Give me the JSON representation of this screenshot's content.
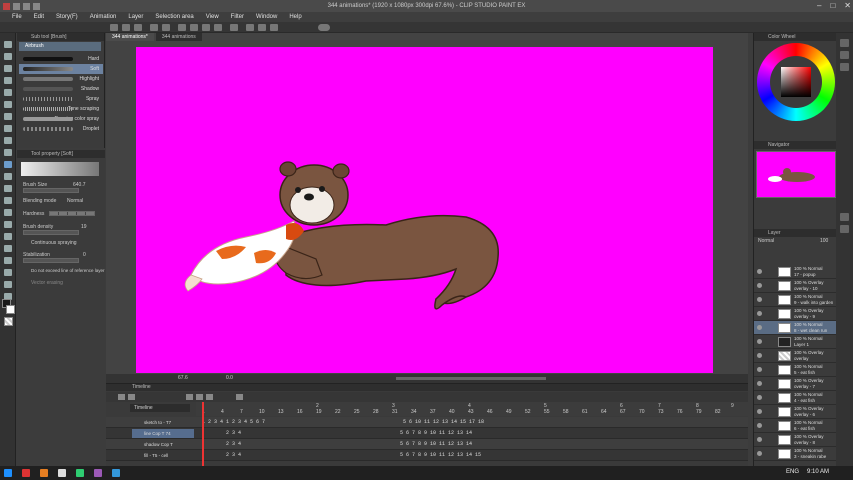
{
  "window": {
    "title": "344 animations* (1920 x 1080px 300dpi 67.6%)  -  CLIP STUDIO PAINT EX",
    "minimize": "–",
    "maximize": "□",
    "close": "✕"
  },
  "menu": [
    "File",
    "Edit",
    "Story(F)",
    "Animation",
    "Layer",
    "Selection area",
    "View",
    "Filter",
    "Window",
    "Help"
  ],
  "subtool": {
    "header": "Sub tool [Brush]",
    "tab": "Airbrush",
    "brushes": [
      "Hard",
      "Soft",
      "Highlight",
      "Shadow",
      "Spray",
      "Tone scraping",
      "Running color spray",
      "Droplet"
    ],
    "selected_index": 1
  },
  "toolprop": {
    "header": "Tool property [Soft]",
    "brush_size_label": "Brush Size",
    "brush_size_value": "640.7",
    "blending_label": "Blending mode",
    "blending_value": "Normal",
    "hardness_label": "Hardness",
    "density_label": "Brush density",
    "density_value": "19",
    "continuous_label": "Continuous spraying",
    "stabilization_label": "Stabilization",
    "stabilization_value": "0",
    "no_exceed_label": "Do not exceed line of reference layer",
    "vector_label": "Vector erasing"
  },
  "doc_tabs": [
    "344 animations*",
    "344 animations"
  ],
  "canvas": {
    "background": "#ff00ff",
    "zoom": "67.6",
    "angle": "0.0"
  },
  "timeline": {
    "header": "Timeline",
    "name_field": "Timeline",
    "ruler_bottom": [
      "1",
      "4",
      "7",
      "10",
      "13",
      "16",
      "19",
      "22",
      "25",
      "28",
      "31",
      "34",
      "37",
      "40",
      "43",
      "46",
      "49",
      "52",
      "55",
      "58",
      "61",
      "64",
      "67",
      "70",
      "73",
      "76",
      "79",
      "82"
    ],
    "ruler_top": [
      "2",
      "3",
      "4",
      "5",
      "6",
      "7",
      "8",
      "9"
    ],
    "tracks": [
      {
        "name": "sketch to - T7",
        "cells": "1 2 3 4 1 2 3 4 5 6 7                                              5 6 10 11 12 13 14 15 17 18"
      },
      {
        "name": "line Cop T 74",
        "cells": "        2 3 4                                                     5 6 7 8 9 10 11 12 13 14"
      },
      {
        "name": "shadow Cop T",
        "cells": "        2 3 4                                                     5 6 7 8 9 10 11 12 13 14"
      },
      {
        "name": "fill - T5 - cell",
        "cells": "        2 3 4                                                     5 6 7 8 9 10 11 12 13 14 15"
      }
    ]
  },
  "layers": {
    "header": "Layer",
    "blend": "Normal",
    "opacity": "100",
    "items": [
      {
        "l1": "100 % Normal",
        "l2": "17 - popup"
      },
      {
        "l1": "100 % Overlay",
        "l2": "overlay - 10"
      },
      {
        "l1": "100 % Normal",
        "l2": "9 - walk into garden"
      },
      {
        "l1": "100 % Overlay",
        "l2": "overlay - 9"
      },
      {
        "l1": "100 % Normal",
        "l2": "8 - wet clean run"
      },
      {
        "l1": "100 % Normal",
        "l2": "Layer 1"
      },
      {
        "l1": "100 % Overlay",
        "l2": "overlay"
      },
      {
        "l1": "100 % Normal",
        "l2": "5 - eat fish"
      },
      {
        "l1": "100 % Overlay",
        "l2": "overlay - 7"
      },
      {
        "l1": "100 % Normal",
        "l2": "4 - eat fish"
      },
      {
        "l1": "100 % Overlay",
        "l2": "overlay - 6"
      },
      {
        "l1": "100 % Normal",
        "l2": "6 - eat fish"
      },
      {
        "l1": "100 % Overlay",
        "l2": "overlay - 8"
      },
      {
        "l1": "100 % Normal",
        "l2": "3 - sneakin rabe"
      }
    ]
  },
  "navigator_header": "Navigator",
  "color_header": "Color Wheel",
  "taskbar": {
    "lang": "ENG",
    "time": "9:10 AM"
  },
  "colors": {
    "accent": "#566d8e",
    "canvas_bg": "#ff00ff",
    "playhead": "#ee3333"
  }
}
